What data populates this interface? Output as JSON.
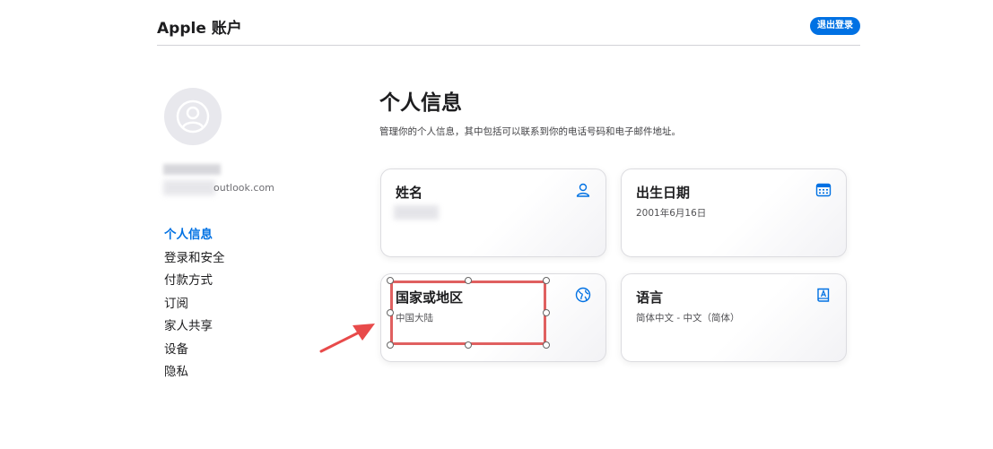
{
  "header": {
    "title": "Apple 账户",
    "signout_label": "退出登录"
  },
  "profile": {
    "email_suffix": "outlook.com"
  },
  "sidebar": {
    "items": [
      {
        "label": "个人信息",
        "active": true
      },
      {
        "label": "登录和安全"
      },
      {
        "label": "付款方式"
      },
      {
        "label": "订阅"
      },
      {
        "label": "家人共享"
      },
      {
        "label": "设备"
      },
      {
        "label": "隐私"
      }
    ]
  },
  "main": {
    "title": "个人信息",
    "subtitle": "管理你的个人信息，其中包括可以联系到你的电话号码和电子邮件地址。",
    "cards": {
      "name": {
        "title": "姓名",
        "icon": "person-icon"
      },
      "birthday": {
        "title": "出生日期",
        "value": "2001年6月16日",
        "icon": "calendar-icon"
      },
      "country": {
        "title": "国家或地区",
        "value": "中国大陆",
        "icon": "globe-icon"
      },
      "language": {
        "title": "语言",
        "value": "简体中文 - 中文（简体）",
        "icon": "book-icon"
      }
    }
  },
  "colors": {
    "accent": "#0071e3",
    "annotation": "#e06060"
  }
}
